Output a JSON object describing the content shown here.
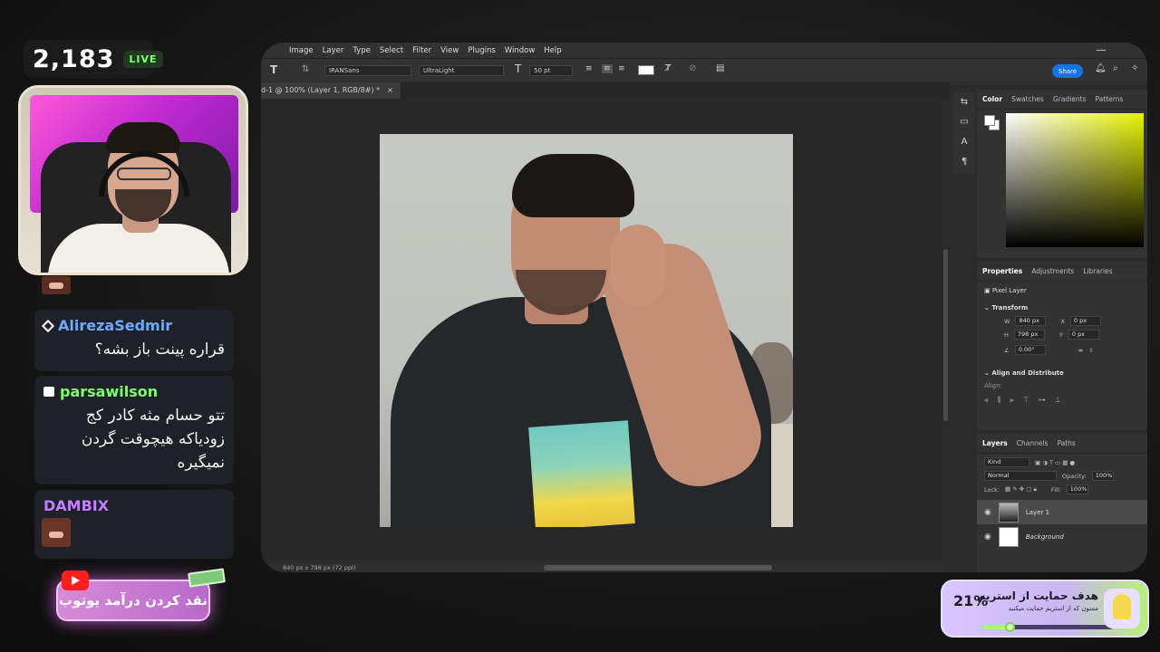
{
  "stream": {
    "viewer_count": "2,183",
    "live_label": "LIVE"
  },
  "chat": {
    "messages": [
      {
        "user": "AlirezaSedmir",
        "user_color": "#6ea8ff",
        "text": "قراره پینت باز بشه؟"
      },
      {
        "user": "parsawilson",
        "user_color": "#7cff6b",
        "text": "تتو حسام مثه کادر کج زودیاکه هیچوقت گردن نمیگیره"
      },
      {
        "user": "DAMBIX",
        "user_color": "#c77dff",
        "text": ""
      }
    ]
  },
  "promo": {
    "youtube_label": "نقد کردن درآمد یوتوب"
  },
  "photoshop": {
    "menu": [
      "Image",
      "Layer",
      "Type",
      "Select",
      "Filter",
      "View",
      "Plugins",
      "Window",
      "Help"
    ],
    "options": {
      "font_family": "IRANSans",
      "font_style": "UltraLight",
      "font_size": "50 pt",
      "share_label": "Share"
    },
    "tab_title": "d-1 @ 100% (Layer 1, RGB/8#) *",
    "status": "840 px x 798 px (72 ppi)",
    "color_tabs": [
      "Color",
      "Swatches",
      "Gradients",
      "Patterns"
    ],
    "properties_tabs": [
      "Properties",
      "Adjustments",
      "Libraries"
    ],
    "properties": {
      "kind": "Pixel Layer",
      "transform_label": "Transform",
      "w": "840 px",
      "h": "798 px",
      "x": "0 px",
      "y": "0 px",
      "angle": "0.00°",
      "align_label": "Align and Distribute",
      "align_sub": "Align:"
    },
    "layers_tabs": [
      "Layers",
      "Channels",
      "Paths"
    ],
    "layers_panel": {
      "filter": "Kind",
      "blend": "Normal",
      "opacity_label": "Opacity:",
      "opacity": "100%",
      "lock_label": "Lock:",
      "fill_label": "Fill:",
      "fill": "100%"
    },
    "layers": [
      {
        "name": "Layer 1",
        "selected": true
      },
      {
        "name": "Background",
        "selected": false
      }
    ]
  },
  "goal": {
    "percent": "21%",
    "percent_value": 21,
    "title": "هدف حمایت از استریم",
    "subtitle": "ممنون که از استریم حمایت میکنید"
  }
}
